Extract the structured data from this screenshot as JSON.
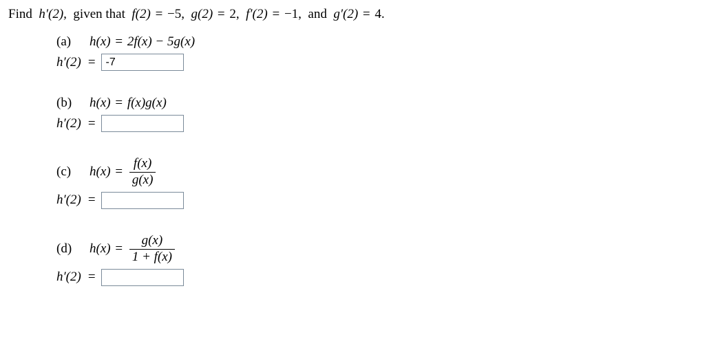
{
  "prompt": {
    "lead": "Find",
    "target": "h′(2),",
    "given_lead": "given that",
    "f2_lhs": "f(2)",
    "f2_val": "−5,",
    "g2_lhs": "g(2)",
    "g2_val": "2,",
    "fp2_lhs": "f′(2)",
    "fp2_val": "−1,",
    "and": "and",
    "gp2_lhs": "g′(2)",
    "gp2_val": "4.",
    "eq": "="
  },
  "parts": {
    "a": {
      "label": "(a)",
      "defn_lhs": "h(x)",
      "defn_rhs": "2f(x) − 5g(x)",
      "answer_lhs": "h′(2)",
      "eq": "=",
      "value": "-7"
    },
    "b": {
      "label": "(b)",
      "defn_lhs": "h(x)",
      "defn_rhs": "f(x)g(x)",
      "answer_lhs": "h′(2)",
      "eq": "=",
      "value": ""
    },
    "c": {
      "label": "(c)",
      "defn_lhs": "h(x)",
      "frac_num": "f(x)",
      "frac_den": "g(x)",
      "answer_lhs": "h′(2)",
      "eq": "=",
      "value": ""
    },
    "d": {
      "label": "(d)",
      "defn_lhs": "h(x)",
      "frac_num": "g(x)",
      "frac_den": "1 + f(x)",
      "answer_lhs": "h′(2)",
      "eq": "=",
      "value": ""
    }
  }
}
